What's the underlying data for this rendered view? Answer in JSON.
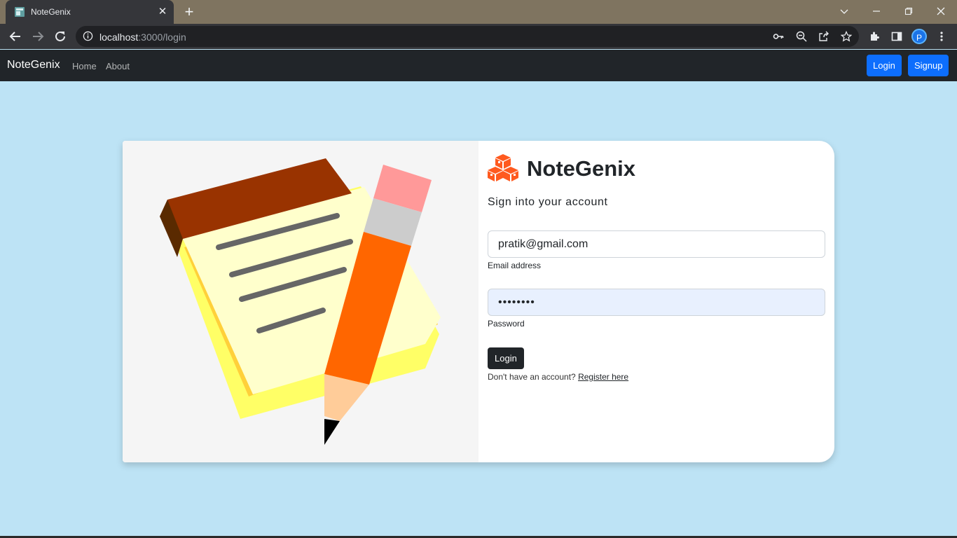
{
  "browser": {
    "tab_title": "NoteGenix",
    "url_host": "localhost",
    "url_path": ":3000/login",
    "profile_initial": "P"
  },
  "navbar": {
    "brand": "NoteGenix",
    "links": [
      "Home",
      "About"
    ],
    "login_label": "Login",
    "signup_label": "Signup"
  },
  "login_card": {
    "app_name": "NoteGenix",
    "subtitle": "Sign into your account",
    "email_value": "pratik@gmail.com",
    "email_label": "Email address",
    "password_value": "••••••••",
    "password_label": "Password",
    "submit_label": "Login",
    "register_prompt": "Don't have an account?",
    "register_link": "Register here"
  },
  "colors": {
    "accent": "#0d6efd",
    "navbar_bg": "#212529",
    "page_bg": "#bde3f5",
    "logo": "#ff5a1f"
  }
}
